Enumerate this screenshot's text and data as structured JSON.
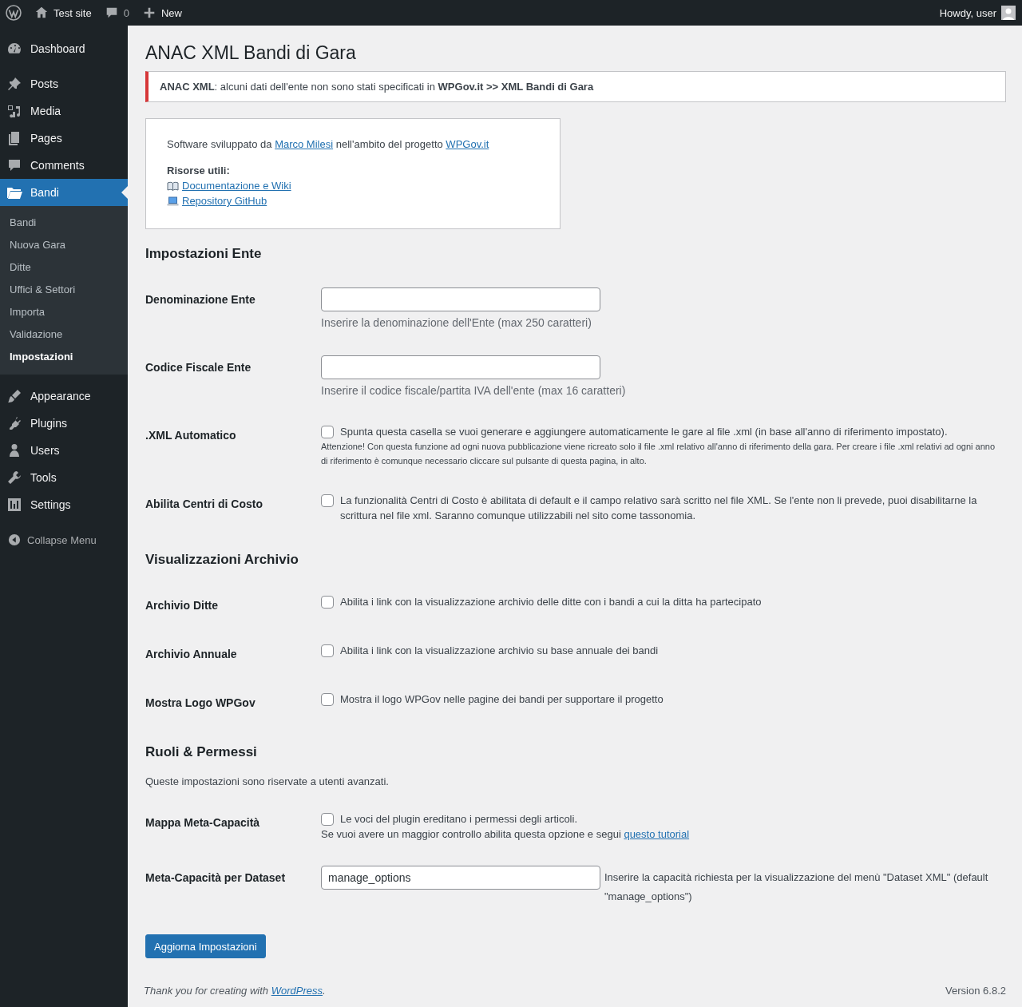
{
  "admin_bar": {
    "site_name": "Test site",
    "comments_count": "0",
    "new_label": "New",
    "greeting": "Howdy, user"
  },
  "sidebar": {
    "groups": [
      [
        {
          "label": "Dashboard",
          "selected": false
        }
      ],
      [
        {
          "label": "Posts",
          "selected": false
        },
        {
          "label": "Media",
          "selected": false
        },
        {
          "label": "Pages",
          "selected": false
        },
        {
          "label": "Comments",
          "selected": false
        },
        {
          "label": "Bandi",
          "selected": true,
          "submenu": [
            {
              "label": "Bandi",
              "selected": false
            },
            {
              "label": "Nuova Gara",
              "selected": false
            },
            {
              "label": "Ditte",
              "selected": false
            },
            {
              "label": "Uffici & Settori",
              "selected": false
            },
            {
              "label": "Importa",
              "selected": false
            },
            {
              "label": "Validazione",
              "selected": false
            },
            {
              "label": "Impostazioni",
              "selected": true
            }
          ]
        }
      ],
      [
        {
          "label": "Appearance",
          "selected": false
        },
        {
          "label": "Plugins",
          "selected": false
        },
        {
          "label": "Users",
          "selected": false
        },
        {
          "label": "Tools",
          "selected": false
        },
        {
          "label": "Settings",
          "selected": false
        }
      ]
    ],
    "collapse_label": "Collapse Menu"
  },
  "page": {
    "title": "ANAC XML Bandi di Gara",
    "notice": "**ANAC XML**: alcuni dati dell'ente non sono stati specificati in **WPGov.it >> XML Bandi di Gara**",
    "info_box": {
      "intro": [
        {
          "text": "Software sviluppato da "
        },
        {
          "link": "Marco Milesi"
        },
        {
          "text": " nell'ambito del progetto "
        },
        {
          "link": "WPGov.it"
        }
      ],
      "resources_title": "Risorse utili:",
      "resources": [
        {
          "link": "Documentazione e Wiki"
        },
        {
          "link": "Repository GitHub"
        }
      ]
    },
    "sections": [
      {
        "heading": "Impostazioni Ente",
        "rows": [
          {
            "kind": "text",
            "label": "Denominazione Ente",
            "description": "Inserire la denominazione dell'Ente (max 250 caratteri)"
          },
          {
            "kind": "text",
            "label": "Codice Fiscale Ente",
            "description": "Inserire il codice fiscale/partita IVA dell'ente (max 16 caratteri)"
          },
          {
            "kind": "checkbox",
            "label": ".XML Automatico",
            "checked": false,
            "text": "Spunta questa casella se vuoi generare e aggiungere automaticamente le gare al file .xml (in base all'anno di riferimento impostato).",
            "note": "Attenzione! Con questa funzione ad ogni nuova pubblicazione viene ricreato solo il file .xml relativo all'anno di riferimento della gara. Per creare i file .xml relativi ad ogni anno di riferimento è comunque necessario cliccare sul pulsante di questa pagina, in alto."
          },
          {
            "kind": "checkbox",
            "label": "Abilita Centri di Costo",
            "checked": false,
            "text": "La funzionalità Centri di Costo è abilitata di default e il campo relativo sarà scritto nel file XML. Se l'ente non li prevede, puoi disabilitarne la scrittura nel file xml. Saranno comunque utilizzabili nel sito come tassonomia."
          }
        ]
      },
      {
        "heading": "Visualizzazioni Archivio",
        "rows": [
          {
            "kind": "checkbox",
            "label": "Archivio Ditte",
            "checked": false,
            "text": "Abilita i link con la visualizzazione archivio delle ditte con i bandi a cui la ditta ha partecipato"
          },
          {
            "kind": "checkbox",
            "label": "Archivio Annuale",
            "checked": false,
            "text": "Abilita i link con la visualizzazione archivio su base annuale dei bandi"
          },
          {
            "kind": "checkbox",
            "label": "Mostra Logo WPGov",
            "checked": false,
            "text": "Mostra il logo WPGov nelle pagine dei bandi per supportare il progetto"
          }
        ]
      },
      {
        "heading": "Ruoli & Permessi",
        "description": "Queste impostazioni sono riservate a utenti avanzati.",
        "rows": [
          {
            "kind": "checkbox",
            "label": "Mappa Meta-Capacità",
            "checked": false,
            "text": "Le voci del plugin ereditano i permessi degli articoli.",
            "hint": [
              {
                "text": "Se vuoi avere un maggior controllo abilita questa opzione e segui "
              },
              {
                "link": "questo tutorial"
              }
            ]
          },
          {
            "kind": "text_inline",
            "label": "Meta-Capacità per Dataset",
            "value": "manage_options",
            "description": "Inserire la capacità richiesta per la visualizzazione del menù \"Dataset XML\" (default \"manage_options\")"
          }
        ]
      }
    ],
    "submit_label": "Aggiorna Impostazioni"
  },
  "footer": {
    "thanks": [
      {
        "text": "Thank you for creating with "
      },
      {
        "link": "WordPress"
      },
      {
        "text": "."
      }
    ],
    "version": "Version 6.8.2"
  }
}
